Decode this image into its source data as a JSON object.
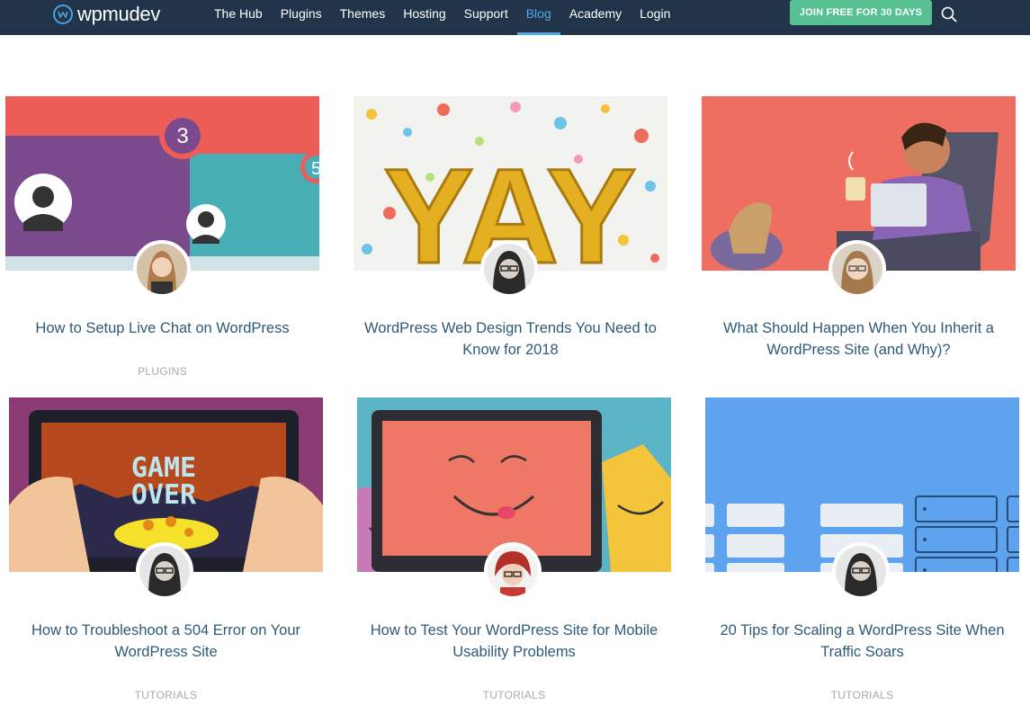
{
  "header": {
    "logo_text": "wpmudev",
    "nav": [
      "The Hub",
      "Plugins",
      "Themes",
      "Hosting",
      "Support",
      "Blog",
      "Academy",
      "Login"
    ],
    "active_nav": "Blog",
    "cta_label": "JOIN FREE FOR 30 DAYS"
  },
  "posts": [
    {
      "title": "How to Setup Live Chat on WordPress",
      "category": "PLUGINS",
      "image_text": [
        "3",
        "5"
      ]
    },
    {
      "title": "WordPress Web Design Trends You Need to Know for 2018",
      "category": "",
      "image_text": [
        "YAY"
      ]
    },
    {
      "title": "What Should Happen When You Inherit a WordPress Site (and Why)?",
      "category": "",
      "image_text": []
    },
    {
      "title": "How to Troubleshoot a 504 Error on Your WordPress Site",
      "category": "TUTORIALS",
      "image_text": [
        "GAME",
        "OVER"
      ]
    },
    {
      "title": "How to Test Your WordPress Site for Mobile Usability Problems",
      "category": "TUTORIALS",
      "image_text": []
    },
    {
      "title": "20 Tips for Scaling a WordPress Site When Traffic Soars",
      "category": "TUTORIALS",
      "image_text": []
    }
  ],
  "colors": {
    "header_bg": "#22344a",
    "accent": "#4fa9e6",
    "cta": "#58c193",
    "title": "#2e5a78",
    "category": "#a9a9a9"
  }
}
